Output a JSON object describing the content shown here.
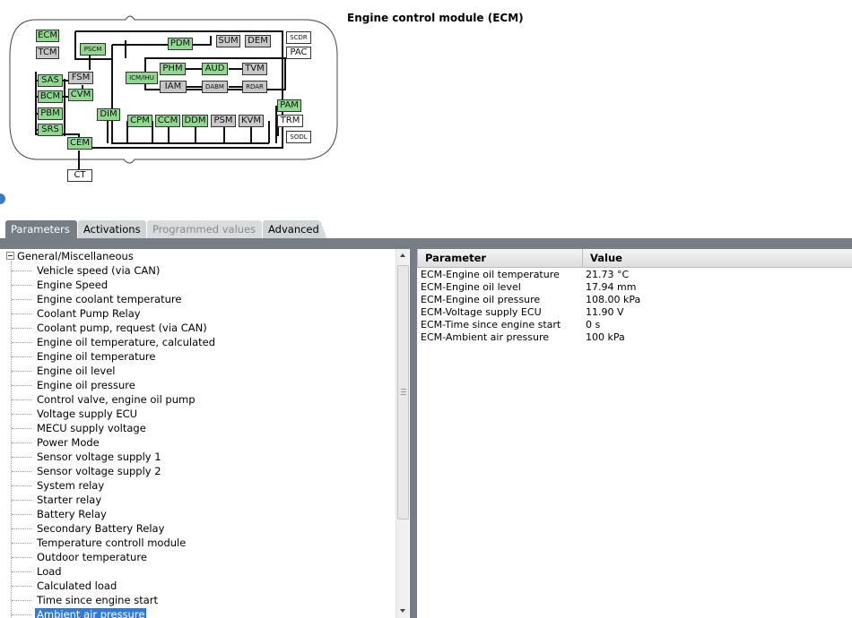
{
  "diagram": {
    "title": "Engine control module (ECM)",
    "modules": {
      "ecm": "ECM",
      "tcm": "TCM",
      "pscm": "PSCM",
      "pdm": "PDM",
      "sum": "SUM",
      "dem": "DEM",
      "scdr": "SCDR",
      "pac": "PAC",
      "sas": "SAS",
      "fsm": "FSM",
      "bcm": "BCM",
      "cvm": "CVM",
      "pbm": "PBM",
      "srs": "SRS",
      "icmihu": "ICM/IHU",
      "phm": "PHM",
      "aud": "AUD",
      "tvm": "TVM",
      "iam": "IAM",
      "dabm": "DABM",
      "rdar": "RDAR",
      "dim": "DIM",
      "cpm": "CPM",
      "ccm": "CCM",
      "ddm": "DDM",
      "psm": "PSM",
      "kvm": "KVM",
      "pam": "PAM",
      "trm": "TRM",
      "sodl": "SODL",
      "cem": "CEM",
      "ct": "CT"
    }
  },
  "tabs": [
    {
      "label": "Parameters",
      "state": "active"
    },
    {
      "label": "Activations",
      "state": "normal"
    },
    {
      "label": "Programmed values",
      "state": "disabled"
    },
    {
      "label": "Advanced",
      "state": "normal"
    }
  ],
  "tree": {
    "root": "General/Miscellaneous",
    "items": [
      "Vehicle speed (via CAN)",
      "Engine Speed",
      "Engine coolant temperature",
      "Coolant Pump Relay",
      "Coolant pump, request (via CAN)",
      "Engine oil temperature, calculated",
      "Engine oil temperature",
      "Engine oil level",
      "Engine oil pressure",
      "Control valve, engine oil pump",
      "Voltage supply ECU",
      "MECU supply voltage",
      "Power Mode",
      "Sensor voltage supply 1",
      "Sensor voltage supply 2",
      "System relay",
      "Starter relay",
      "Battery Relay",
      "Secondary Battery Relay",
      "Temperature controll module",
      "Outdoor temperature",
      "Load",
      "Calculated load",
      "Time since engine start",
      "Ambient air pressure"
    ],
    "selected": "Ambient air pressure"
  },
  "table": {
    "headers": {
      "parameter": "Parameter",
      "value": "Value"
    },
    "rows": [
      {
        "parameter": "ECM-Engine oil temperature",
        "value": "21.73 °C"
      },
      {
        "parameter": "ECM-Engine oil level",
        "value": "17.94 mm"
      },
      {
        "parameter": "ECM-Engine oil pressure",
        "value": "108.00 kPa"
      },
      {
        "parameter": "ECM-Voltage supply ECU",
        "value": "11.90 V"
      },
      {
        "parameter": "ECM-Time since engine start",
        "value": "0 s"
      },
      {
        "parameter": "ECM-Ambient air pressure",
        "value": "100 kPa"
      }
    ]
  },
  "colors": {
    "module_active": "#8fd98f",
    "module_inactive": "#c8c8c8",
    "tab_active": "#767d84",
    "selection": "#2f7bd6"
  }
}
